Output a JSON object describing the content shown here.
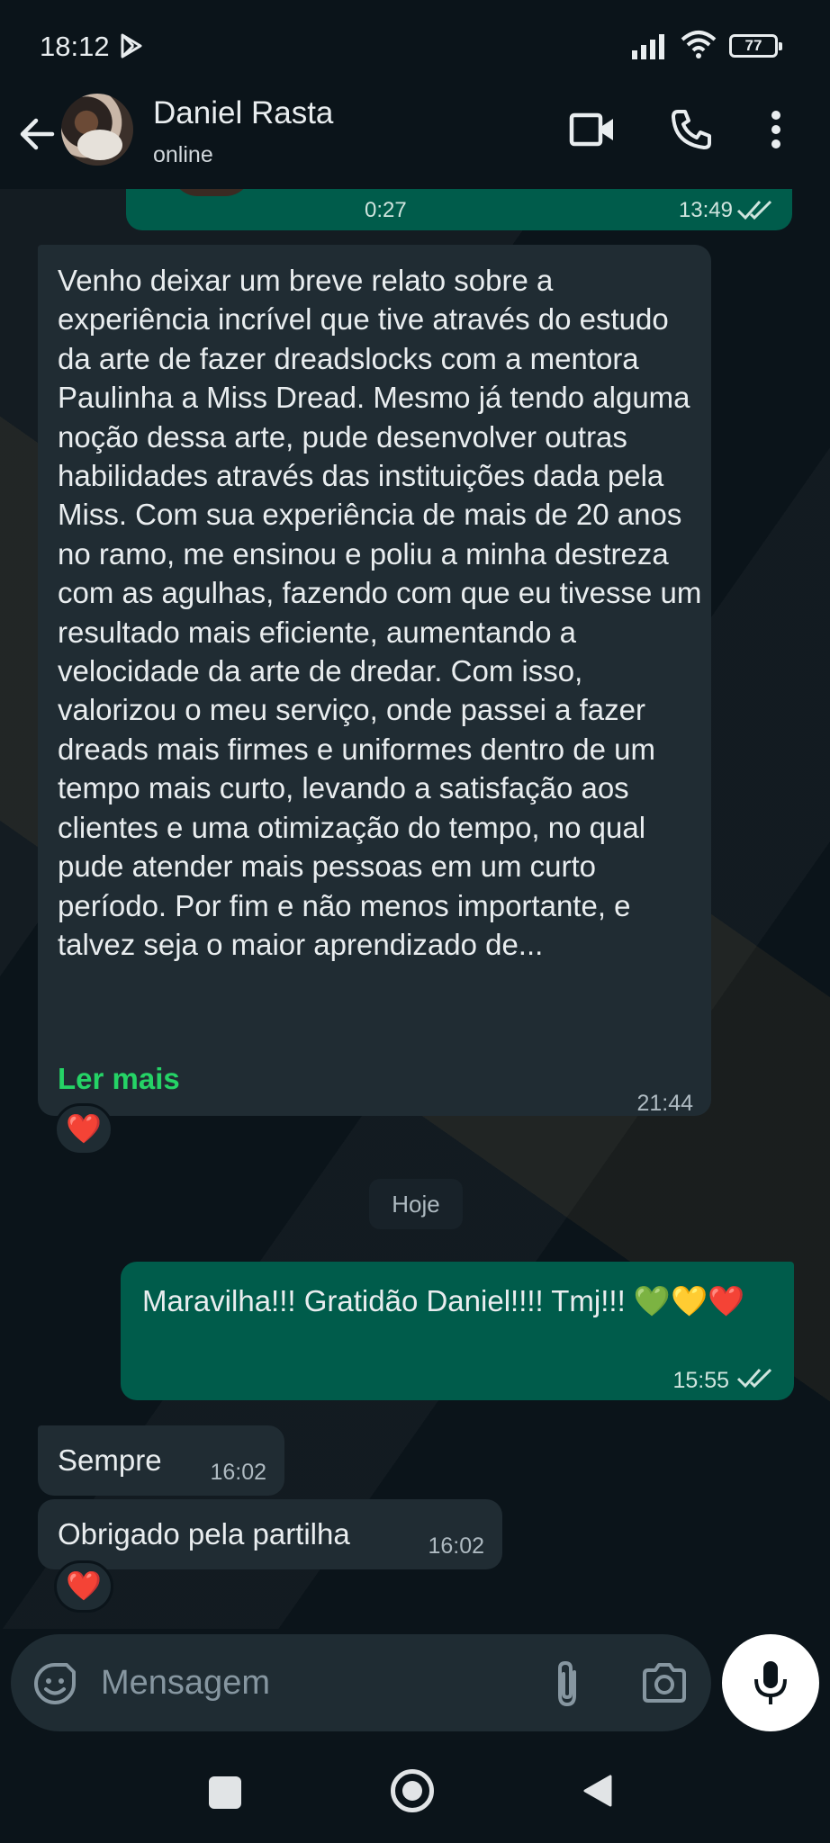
{
  "status_bar": {
    "time": "18:12",
    "battery": "77"
  },
  "header": {
    "contact_name": "Daniel Rasta",
    "contact_status": "online"
  },
  "previous_message": {
    "duration": "0:27",
    "time": "13:49"
  },
  "messages": [
    {
      "direction": "incoming",
      "text": "Venho deixar um breve relato sobre a experiência incrível que tive através do estudo da arte de fazer dreadslocks com a mentora Paulinha a Miss Dread. Mesmo já tendo alguma noção dessa arte, pude desenvolver outras habilidades através das instituições dada pela Miss. Com sua experiência de mais de 20 anos no ramo, me ensinou e poliu a minha destreza com as agulhas, fazendo com que eu tivesse um resultado mais eficiente, aumentando a velocidade da arte de dredar. Com isso, valorizou o meu serviço, onde passei a fazer dreads mais firmes e uniformes dentro de um tempo mais curto, levando a satisfação aos clientes e uma otimização do tempo, no qual pude atender mais pessoas em um curto período. Por fim e não menos importante, e talvez seja o maior aprendizado de...",
      "read_more": "Ler mais",
      "time": "21:44",
      "reaction": "❤️"
    },
    {
      "direction": "outgoing",
      "text": "Maravilha!!! Gratidão Daniel!!!! Tmj!!! 💚💛❤️",
      "time": "15:55"
    },
    {
      "direction": "incoming",
      "text": "Sempre",
      "time": "16:02"
    },
    {
      "direction": "incoming",
      "text": "Obrigado pela partilha",
      "time": "16:02",
      "reaction": "❤️"
    }
  ],
  "date_divider": "Hoje",
  "composer": {
    "placeholder": "Mensagem"
  },
  "colors": {
    "background": "#0b141a",
    "incoming_bubble": "#202c33",
    "outgoing_bubble": "#005c4b",
    "accent": "#25d366"
  },
  "icons": [
    "back-arrow",
    "video-call",
    "voice-call",
    "more-vertical",
    "emoji",
    "attach",
    "camera",
    "mic",
    "double-check"
  ]
}
